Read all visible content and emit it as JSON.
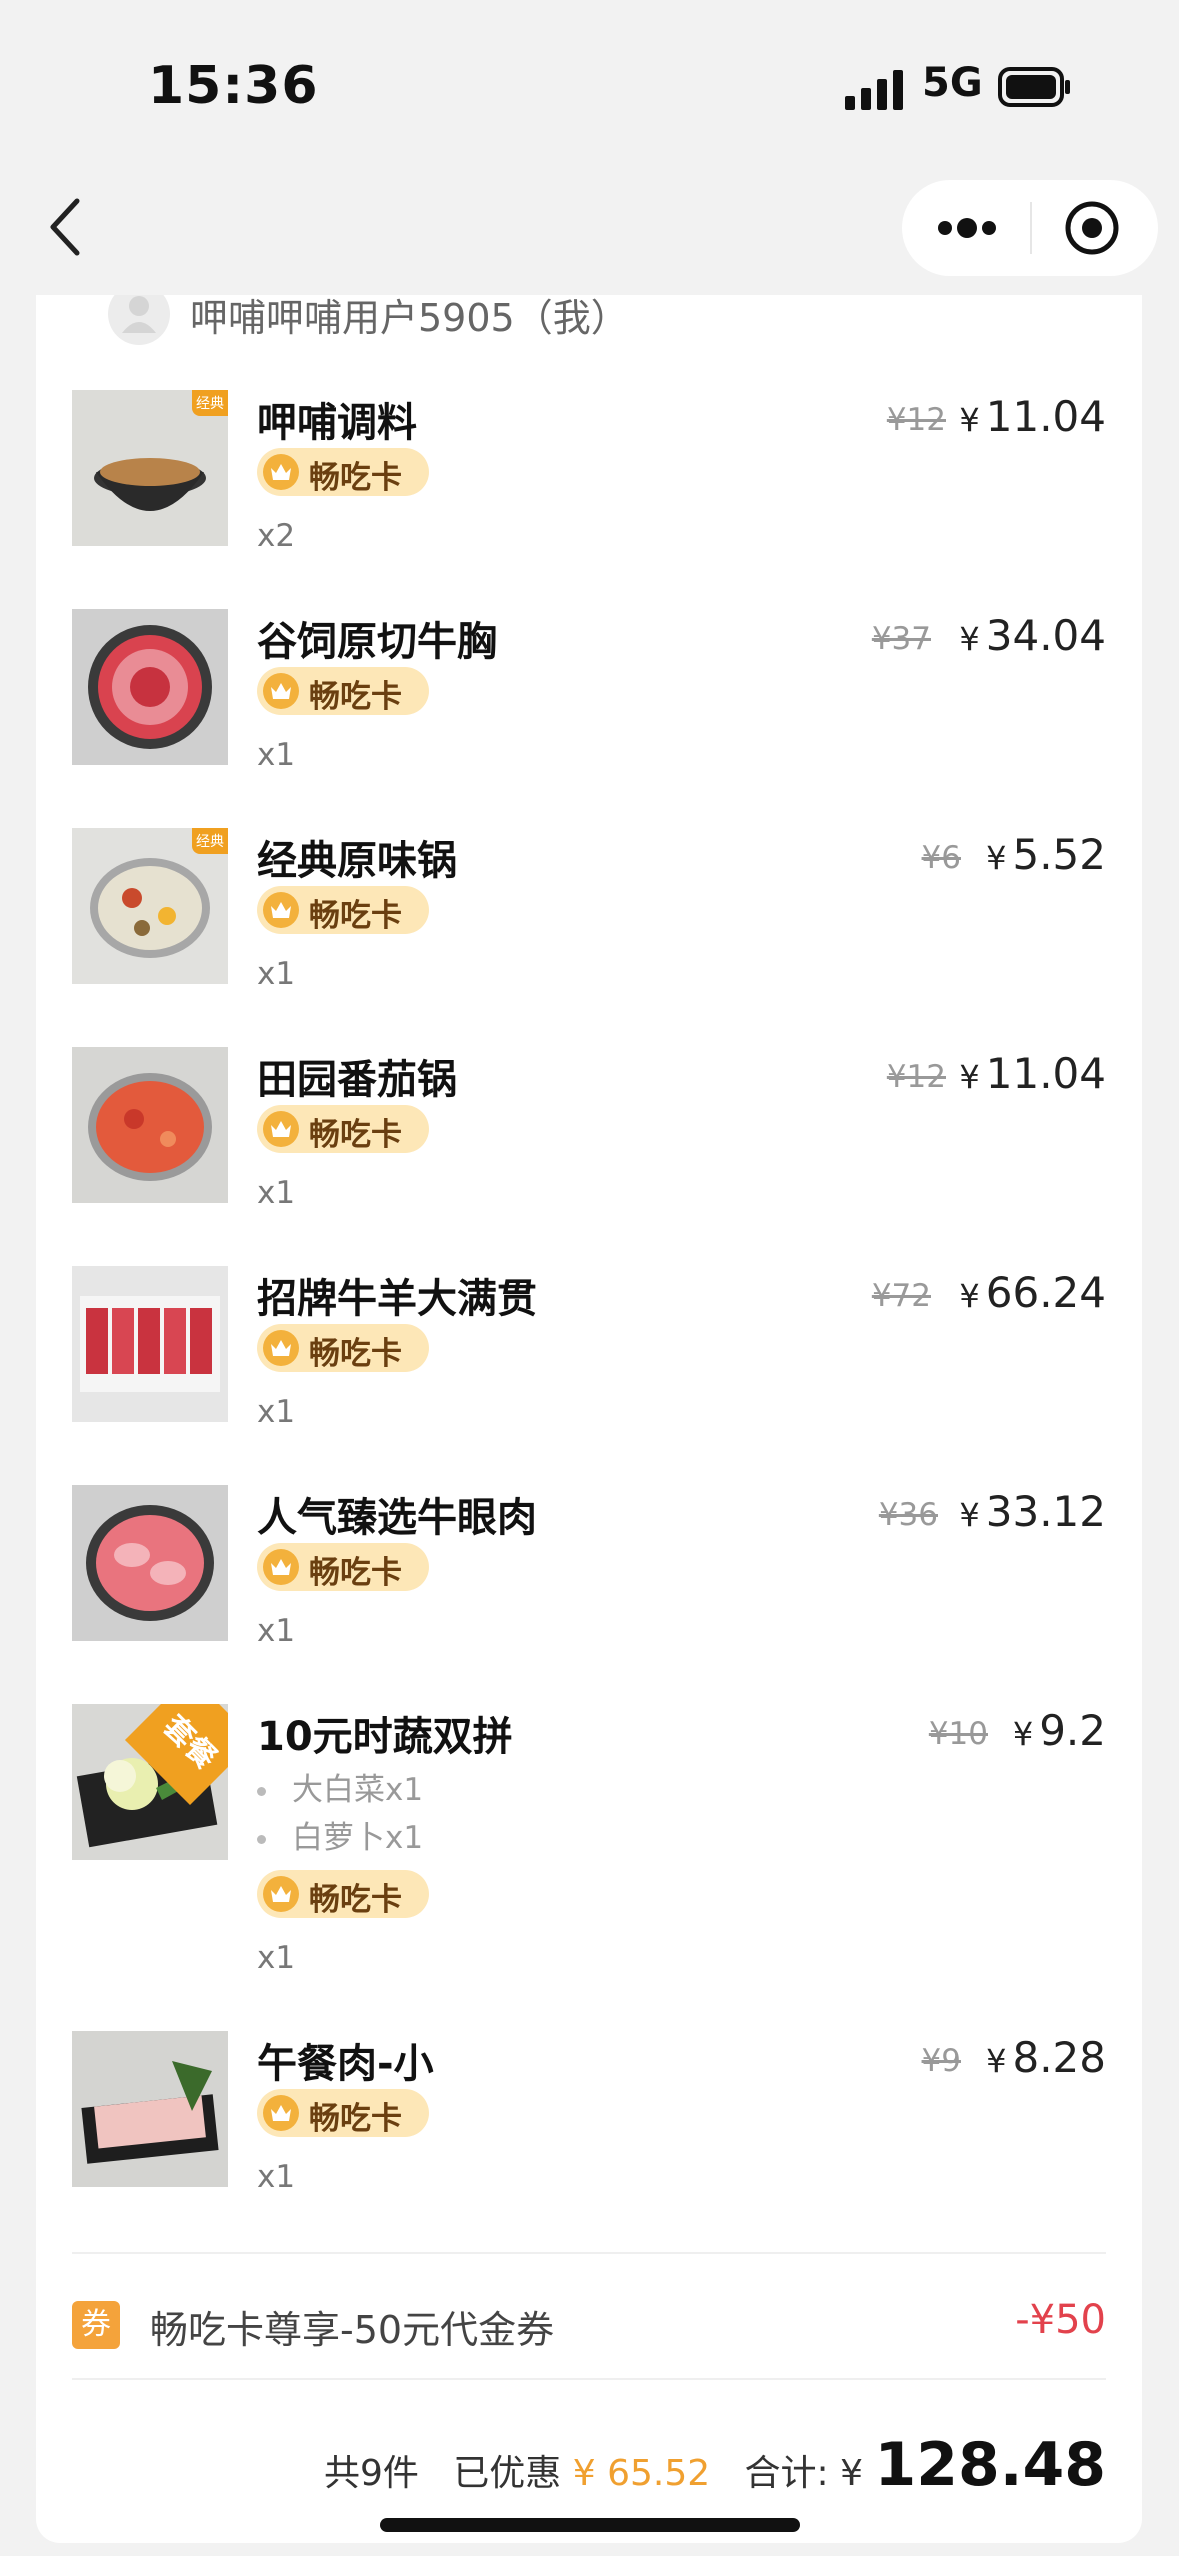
{
  "status_bar": {
    "time": "15:36",
    "network": "5G"
  },
  "user": {
    "name": "呷哺呷哺用户5905（我）"
  },
  "tag_label": "畅吃卡",
  "items": [
    {
      "name": "呷哺调料",
      "original_price": "¥12",
      "price": "11.04",
      "qty": "x2",
      "badge": "经典"
    },
    {
      "name": "谷饲原切牛胸",
      "original_price": "¥37",
      "price": "34.04",
      "qty": "x1"
    },
    {
      "name": "经典原味锅",
      "original_price": "¥6",
      "price": "5.52",
      "qty": "x1",
      "badge": "经典"
    },
    {
      "name": "田园番茄锅",
      "original_price": "¥12",
      "price": "11.04",
      "qty": "x1"
    },
    {
      "name": "招牌牛羊大满贯",
      "original_price": "¥72",
      "price": "66.24",
      "qty": "x1"
    },
    {
      "name": "人气臻选牛眼肉",
      "original_price": "¥36",
      "price": "33.12",
      "qty": "x1"
    },
    {
      "name": "10元时蔬双拼",
      "original_price": "¥10",
      "price": "9.2",
      "qty": "x1",
      "badge": "套餐",
      "sub_items": [
        "大白菜x1",
        "白萝卜x1"
      ]
    },
    {
      "name": "午餐肉-小",
      "original_price": "¥9",
      "price": "8.28",
      "qty": "x1"
    }
  ],
  "coupon": {
    "tag": "券",
    "text": "畅吃卡尊享-50元代金券",
    "amount": "-¥50"
  },
  "summary": {
    "count": "共9件",
    "discount_label": "已优惠",
    "discount": "¥ 65.52",
    "total_label": "合计:",
    "currency": "¥",
    "total": "128.48"
  },
  "colors": {
    "accent": "#f0a030",
    "pill_bg": "#fde7b7",
    "discount_red": "#e2424c"
  }
}
